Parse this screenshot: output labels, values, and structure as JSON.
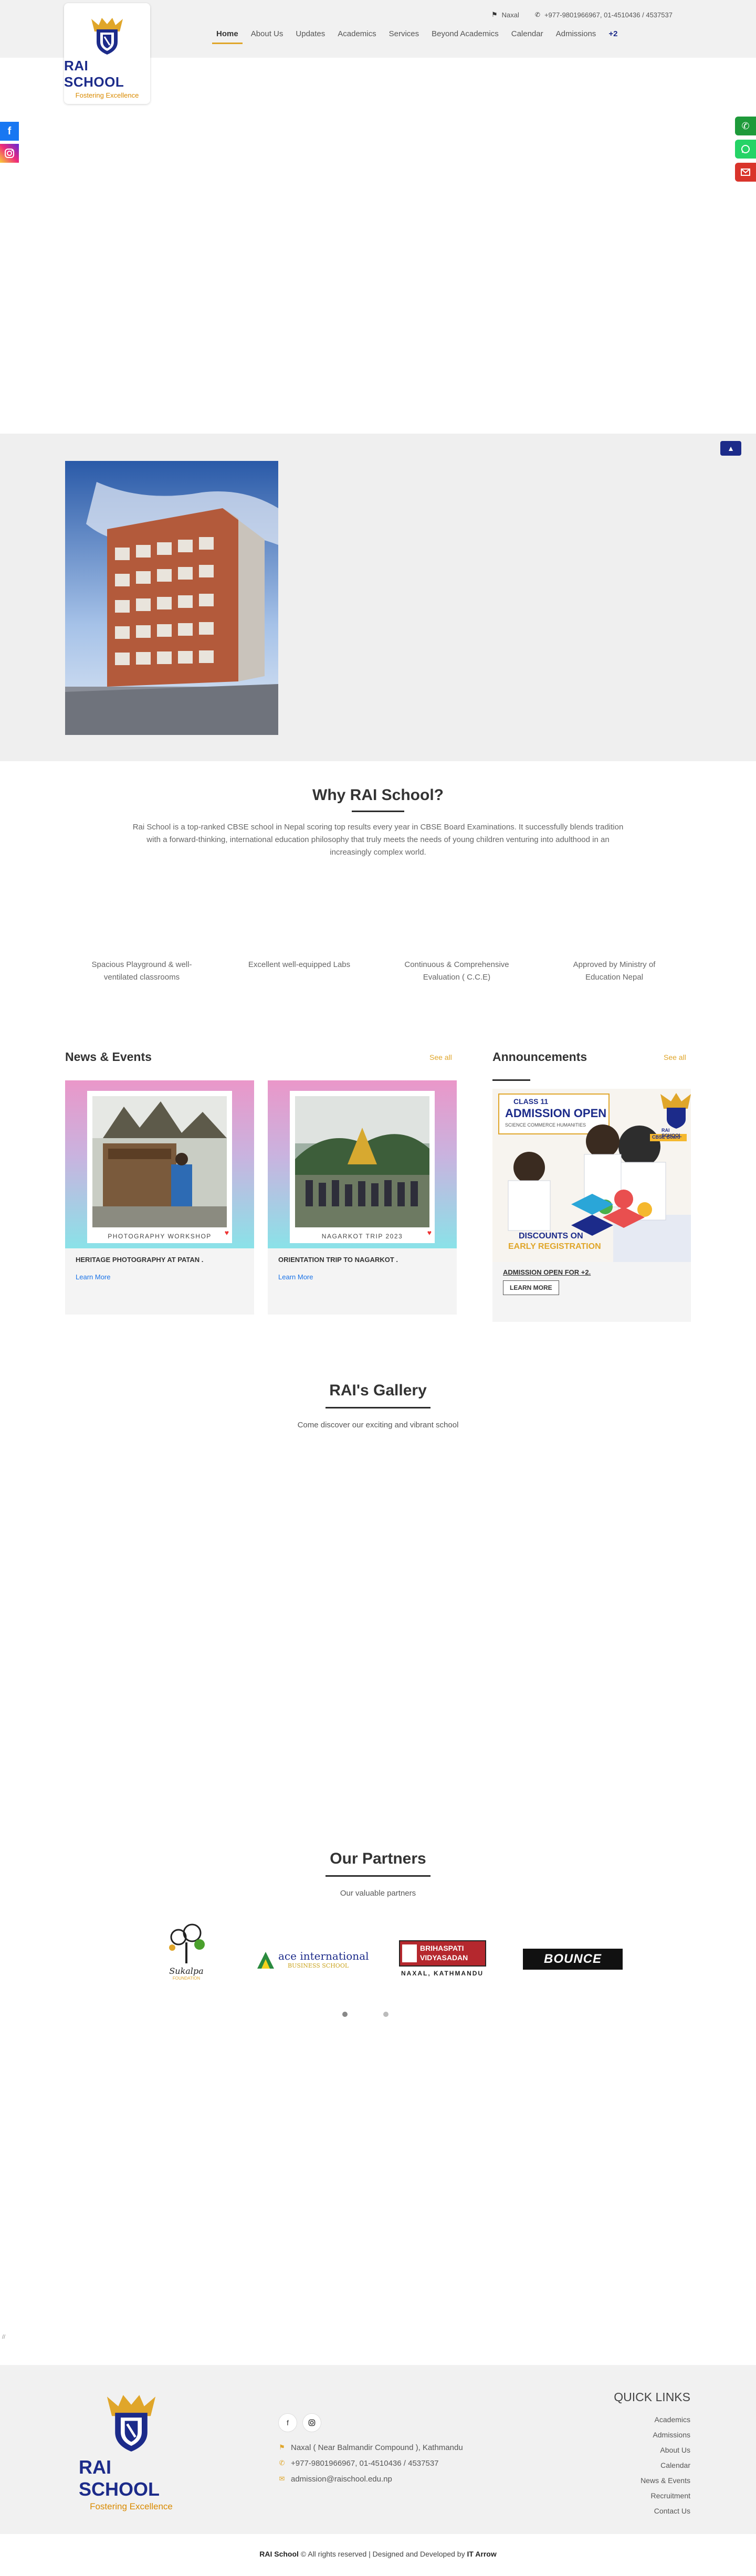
{
  "header": {
    "school_name": "RAI SCHOOL",
    "tagline": "Fostering Excellence",
    "location": "Naxal",
    "phones": "+977-9801966967, 01-4510436 / 4537537"
  },
  "nav": {
    "items": [
      "Home",
      "About Us",
      "Updates",
      "Academics",
      "Services",
      "Beyond Academics",
      "Calendar",
      "Admissions",
      "+2"
    ],
    "active": "Home"
  },
  "why": {
    "title": "Why RAI School?",
    "text": "Rai School is a top-ranked CBSE school in Nepal scoring top results every year in CBSE Board Examinations. It successfully blends tradition with a forward-thinking, international education philosophy that truly meets the needs of young children venturing into adulthood in an increasingly complex world.",
    "features": [
      "Spacious Playground & well-ventilated classrooms",
      "Excellent well-equipped Labs",
      "Continuous & Comprehensive Evaluation ( C.C.E)",
      "Approved by Ministry of Education Nepal"
    ]
  },
  "news": {
    "heading": "News & Events",
    "see_all": "See all",
    "cards": [
      {
        "caption": "PHOTOGRAPHY WORKSHOP",
        "title": "HERITAGE PHOTOGRAPHY AT PATAN .",
        "link": "Learn More"
      },
      {
        "caption": "NAGARKOT TRIP 2023",
        "title": "ORIENTATION TRIP TO NAGARKOT .",
        "link": "Learn More"
      }
    ]
  },
  "announcements": {
    "heading": "Announcements",
    "see_all": "See all",
    "flyer": {
      "class": "CLASS 11",
      "admission": "ADMISSION OPEN",
      "science": "SCIENCE COMMERCE HUMANITIES",
      "board": "CBSE Board",
      "discount": "DISCOUNTS ON",
      "early": "EARLY REGISTRATION",
      "school_name": "RAI SCHOOL"
    },
    "item_title": "ADMISSION OPEN FOR +2.",
    "button": "LEARN MORE"
  },
  "gallery": {
    "title": "RAI's Gallery",
    "subtitle": "Come discover our exciting and vibrant school"
  },
  "partners": {
    "title": "Our Partners",
    "subtitle": "Our valuable partners",
    "logos": [
      {
        "name": "Sukalpa",
        "sub": "FOUNDATION"
      },
      {
        "name": "ace international",
        "sub": "BUSINESS SCHOOL"
      },
      {
        "name": "BRIHASPATI VIDYASADAN",
        "sub": "NAXAL, KATHMANDU"
      },
      {
        "name": "BOUNCE",
        "sub": ""
      }
    ]
  },
  "stray_mark": "//",
  "footer": {
    "school_name": "RAI SCHOOL",
    "tagline": "Fostering Excellence",
    "address": "Naxal ( Near Balmandir Compound ), Kathmandu",
    "phone": "+977-9801966967, 01-4510436 / 4537537",
    "email": "admission@raischool.edu.np",
    "quick_links_title": "QUICK LINKS",
    "quick_links": [
      "Academics",
      "Admissions",
      "About Us",
      "Calendar",
      "News & Events",
      "Recruitment",
      "Contact Us"
    ]
  },
  "copyright": {
    "brand": "RAI School",
    "text": " © All rights reserved | Designed and Developed by ",
    "dev": "IT Arrow"
  },
  "colors": {
    "brand_blue": "#1c2b8a",
    "accent_gold": "#e0a62a",
    "link_blue": "#1a73e8"
  }
}
